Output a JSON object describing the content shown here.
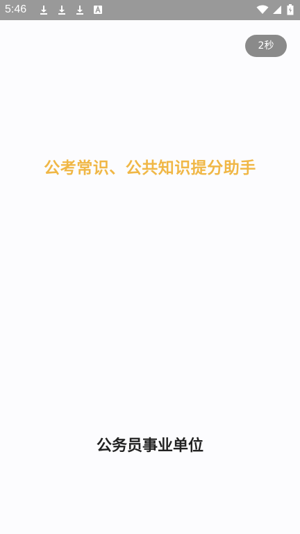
{
  "status_bar": {
    "time": "5:46",
    "icons": [
      "download-icon",
      "download-icon",
      "download-icon",
      "text-a-icon",
      "wifi-icon",
      "signal-icon",
      "battery-icon"
    ]
  },
  "splash": {
    "skip_countdown": "2秒",
    "slogan": "公考常识、公共知识提分助手",
    "app_name": "公务员事业单位"
  },
  "colors": {
    "status_bar_bg": "#999999",
    "skip_button_bg": "#8a8a8a",
    "slogan": "#f0b746",
    "app_name": "#222222",
    "background": "#fcfcfe"
  }
}
